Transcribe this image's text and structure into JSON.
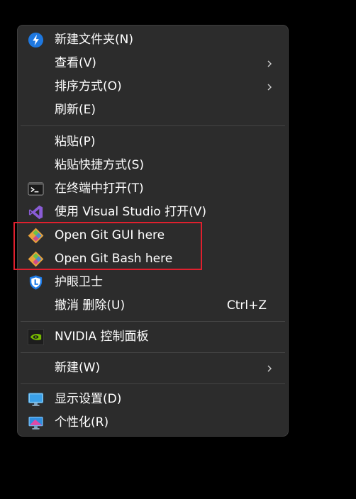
{
  "menu": {
    "items": [
      {
        "label": "新建文件夹(N)",
        "icon": "new-folder-bolt-icon",
        "has_submenu": false
      },
      {
        "label": "查看(V)",
        "icon": "",
        "has_submenu": true
      },
      {
        "label": "排序方式(O)",
        "icon": "",
        "has_submenu": true
      },
      {
        "label": "刷新(E)",
        "icon": "",
        "has_submenu": false
      },
      {
        "label": "粘贴(P)",
        "icon": "",
        "has_submenu": false
      },
      {
        "label": "粘贴快捷方式(S)",
        "icon": "",
        "has_submenu": false
      },
      {
        "label": "在终端中打开(T)",
        "icon": "terminal-icon",
        "has_submenu": false
      },
      {
        "label": "使用 Visual Studio 打开(V)",
        "icon": "visual-studio-icon",
        "has_submenu": false
      },
      {
        "label": "Open Git GUI here",
        "icon": "git-icon",
        "has_submenu": false
      },
      {
        "label": "Open Git Bash here",
        "icon": "git-icon",
        "has_submenu": false
      },
      {
        "label": "护眼卫士",
        "icon": "eye-guard-icon",
        "has_submenu": false
      },
      {
        "label": "撤消 删除(U)",
        "icon": "",
        "has_submenu": false,
        "shortcut": "Ctrl+Z"
      },
      {
        "label": "NVIDIA 控制面板",
        "icon": "nvidia-icon",
        "has_submenu": false
      },
      {
        "label": "新建(W)",
        "icon": "",
        "has_submenu": true
      },
      {
        "label": "显示设置(D)",
        "icon": "display-settings-icon",
        "has_submenu": false
      },
      {
        "label": "个性化(R)",
        "icon": "personalize-icon",
        "has_submenu": false
      }
    ]
  },
  "colors": {
    "menu_background": "#2c2c2c",
    "highlight_border": "#e0202e",
    "text": "#ffffff"
  }
}
